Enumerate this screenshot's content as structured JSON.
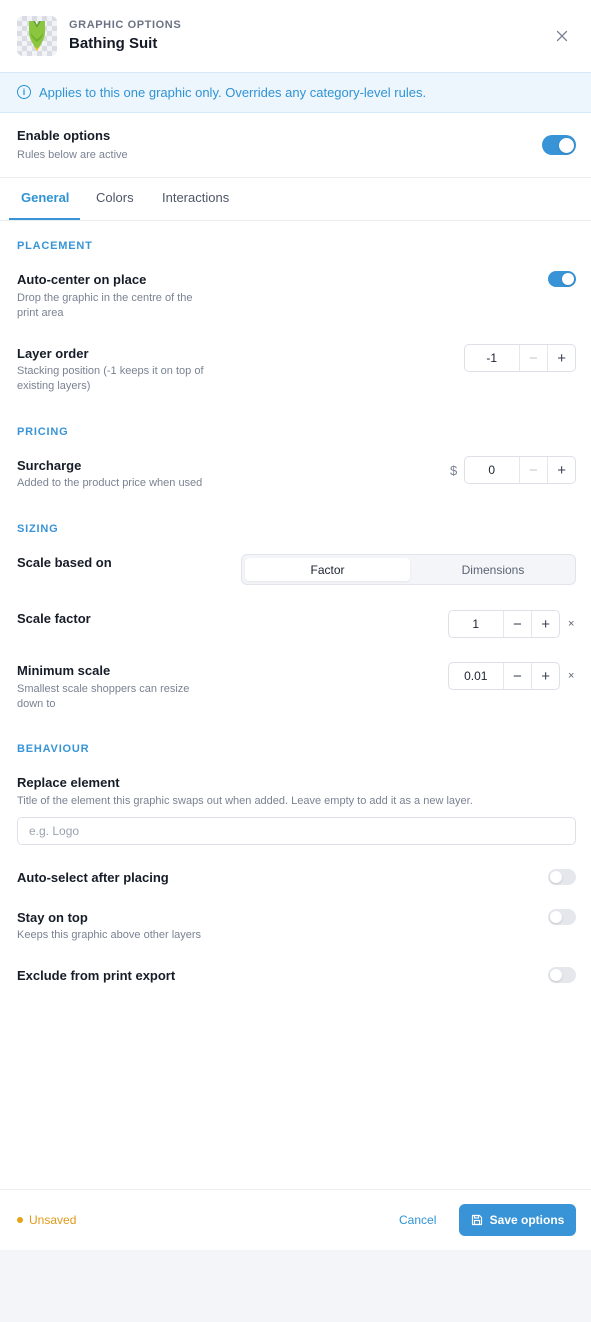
{
  "header": {
    "eyebrow": "GRAPHIC OPTIONS",
    "title": "Bathing Suit",
    "close_icon": "close-icon",
    "thumbnail_icon": "bathing-suit-icon"
  },
  "info": {
    "text": "Applies to this one graphic only. Overrides any category-level rules.",
    "icon": "info-icon"
  },
  "enable": {
    "label": "Enable options",
    "sub": "Rules below are active",
    "on": true
  },
  "tabs": [
    {
      "label": "General",
      "active": true
    },
    {
      "label": "Colors",
      "active": false
    },
    {
      "label": "Interactions",
      "active": false
    }
  ],
  "placement": {
    "heading": "PLACEMENT",
    "auto_center": {
      "label": "Auto-center on place",
      "sub_line1": "Drop the graphic in the centre of the",
      "sub_line2": "print area",
      "on": true
    },
    "layer_order": {
      "label": "Layer order",
      "sub_line1": "Stacking position (-1 keeps it on top of",
      "sub_line2": "existing layers)",
      "value": "-1",
      "minus": "−",
      "plus": "+"
    }
  },
  "pricing": {
    "heading": "PRICING",
    "surcharge": {
      "label": "Surcharge",
      "sub": "Added to the product price when used",
      "currency": "$",
      "value": "0",
      "minus": "−",
      "plus": "+"
    }
  },
  "sizing": {
    "heading": "SIZING",
    "scale_based_on": {
      "label": "Scale based on",
      "options": [
        "Factor",
        "Dimensions"
      ],
      "selected": "Factor"
    },
    "scale_factor": {
      "label": "Scale factor",
      "value": "1",
      "minus": "−",
      "plus": "+",
      "suffix": "×"
    },
    "minimum_scale": {
      "label": "Minimum scale",
      "sub_line1": "Smallest scale shoppers can resize",
      "sub_line2": "down to",
      "value": "0.01",
      "minus": "−",
      "plus": "+",
      "suffix": "×"
    }
  },
  "behaviour": {
    "heading": "BEHAVIOUR",
    "replace_element": {
      "label": "Replace element",
      "sub": "Title of the element this graphic swaps out when added. Leave empty to add it as a new layer.",
      "value": "",
      "placeholder": "e.g. Logo"
    },
    "auto_select": {
      "label": "Auto-select after placing",
      "on": false
    },
    "stay_on_top": {
      "label": "Stay on top",
      "sub": "Keeps this graphic above other layers",
      "on": false
    },
    "exclude_print": {
      "label": "Exclude from print export",
      "on": false
    }
  },
  "footer": {
    "status": "Unsaved",
    "cancel": "Cancel",
    "save": "Save options",
    "save_icon": "save-icon"
  },
  "colors": {
    "accent": "#3894d6",
    "unsaved": "#e0991a",
    "info_bg": "#eef6fd"
  }
}
